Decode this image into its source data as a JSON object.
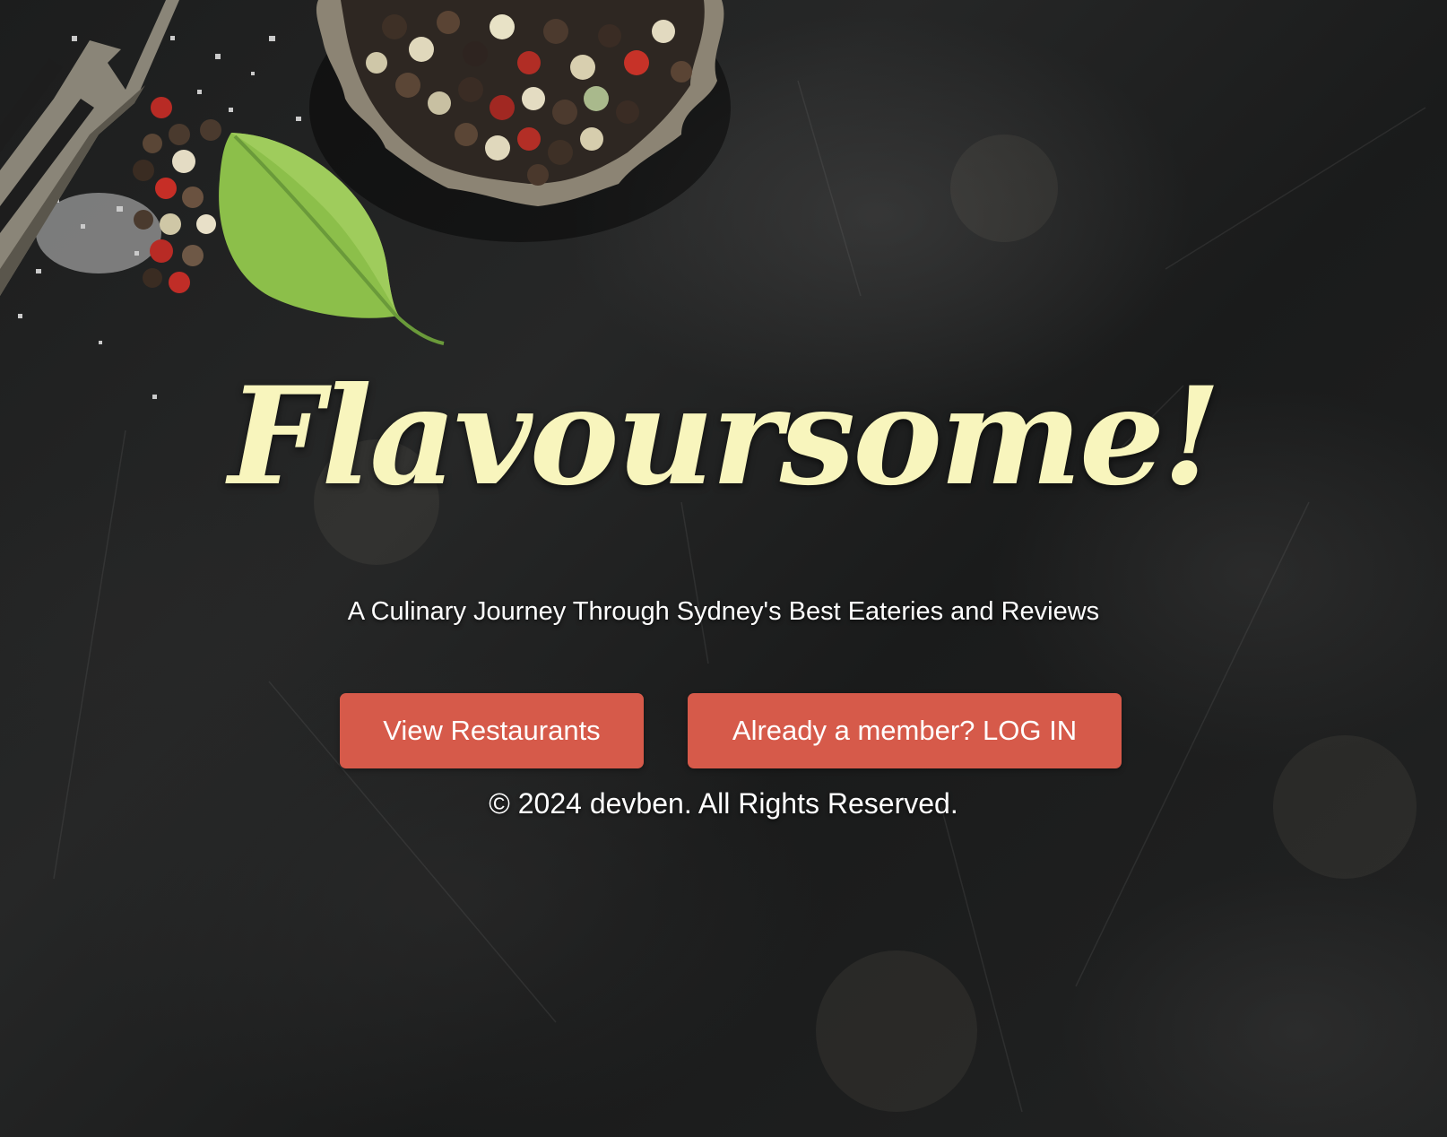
{
  "hero": {
    "title": "Flavoursome!",
    "subtitle": "A Culinary Journey Through Sydney's Best Eateries and Reviews"
  },
  "actions": {
    "view_restaurants_label": "View Restaurants",
    "login_label": "Already a member? LOG IN"
  },
  "footer": {
    "copyright": "© 2024 devben. All Rights Reserved."
  },
  "colors": {
    "title": "#f8f5bd",
    "button": "#d65a4a",
    "background": "#1f2020"
  },
  "decor": {
    "icons": [
      "fork-icon",
      "pepper-bowl-icon",
      "basil-leaf-icon",
      "salt-crystals-icon"
    ]
  }
}
